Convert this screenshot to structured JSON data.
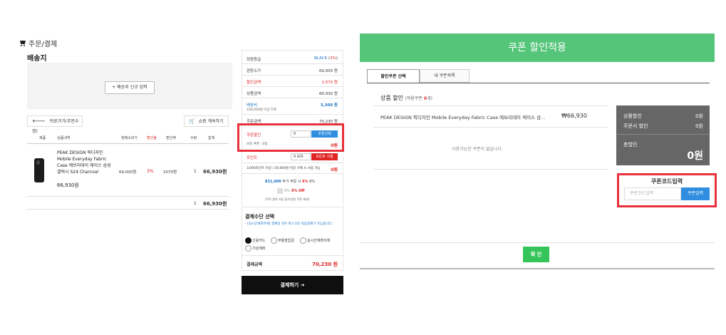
{
  "checkout": {
    "breadcrumb": "주문/결제",
    "shipping_title": "배송지",
    "new_address_btn": "+ 배송지 신규 입력",
    "back_btn": "뒤로가기(주문수정)",
    "continue_btn": "쇼핑 계속하기",
    "table_headers": [
      "제품",
      "상품내역",
      "판매소비가",
      "할인율",
      "할인액",
      "수량",
      "합계"
    ],
    "product": {
      "name": "PEAK DESIGN 픽디자인 Mobile Everyday Fabric Case 에브리데이 케이스 삼성 갤럭시 S24 Charcoal",
      "price": "66,930원",
      "list_price": "69,000원",
      "discount_rate": "3%",
      "discount_amount": "2070원",
      "qty": "1",
      "total": "66,930원"
    },
    "total_row": {
      "qty": "1",
      "total": "66,930원"
    }
  },
  "summary": {
    "member_grade_label": "회원등급",
    "member_grade_value": "BLACK",
    "member_grade_rate": "3%",
    "list_total_label": "권장소가",
    "list_total_value": "69,000 원",
    "discount_label": "할인금액",
    "discount_value": "2,070 원",
    "product_amount_label": "상품금액",
    "product_amount_value": "66,930 원",
    "shipping_label": "배송비",
    "shipping_value": "3,300 원",
    "shipping_note": "100,000원 이상 무료",
    "order_amount_label": "주문금액",
    "order_amount_value": "70,230 원",
    "coupon_label": "쿠폰할인",
    "coupon_input": "0",
    "coupon_btn": "쿠폰선택",
    "coupon_owned": "보유 쿠폰 : 0장",
    "coupon_amount": "0원",
    "point_label": "포인트",
    "point_input": "0 보유",
    "point_btn": "모든트 사용",
    "point_note": "3,000포인트 이상 / 20,000원 이상 구매 시 사용 가능",
    "point_amount": "0원",
    "earn_prefix": "831,000",
    "earn_mid": " 주기 주문 시 ",
    "earn_rate1": "6%",
    "earn_rate2": " 6%",
    "earn_check_text": "6%",
    "earn_off": "6% Off",
    "earn_note": "(쿠폰 중복 사용 불가/일반 쿠폰 제외)",
    "pay_method_title": "결제수단 선택",
    "pay_method_note": "- [실시간계좌이체] 결제의 경우 퀵스크린 적용결제가 가능합니다.",
    "pay_methods": [
      "신용카드",
      "무통장입금",
      "실시간계좌이체",
      "가상계좌"
    ],
    "final_label": "결제금액",
    "final_value": "70,230 원",
    "pay_btn": "결제하기 ➔"
  },
  "coupon_modal": {
    "title": "쿠폰 할인적용",
    "tab_select": "할인쿠폰 선택",
    "tab_my": "내 쿠폰목록",
    "section_title": "상품 할인",
    "applicable_prefix": "(적용쿠폰 ",
    "applicable_count": "0",
    "applicable_suffix": "개)",
    "product_line": "PEAK DESIGN 픽디자인 Mobile Everyday Fabric Case 에브리데이 케이스 삼...",
    "product_price": "₩66,930",
    "no_coupon": "사용가능한 쿠폰이 없습니다.",
    "summary": {
      "product_discount_label": "상품할인",
      "product_discount_value": "0원",
      "order_discount_label": "주문서 할인",
      "order_discount_value": "0원",
      "total_discount_label": "총할인",
      "total_discount_value": "0원"
    },
    "code_title": "쿠폰코드입력",
    "code_placeholder": "쿠폰코드입력",
    "code_btn": "쿠폰입력",
    "confirm_btn": "확 인"
  }
}
